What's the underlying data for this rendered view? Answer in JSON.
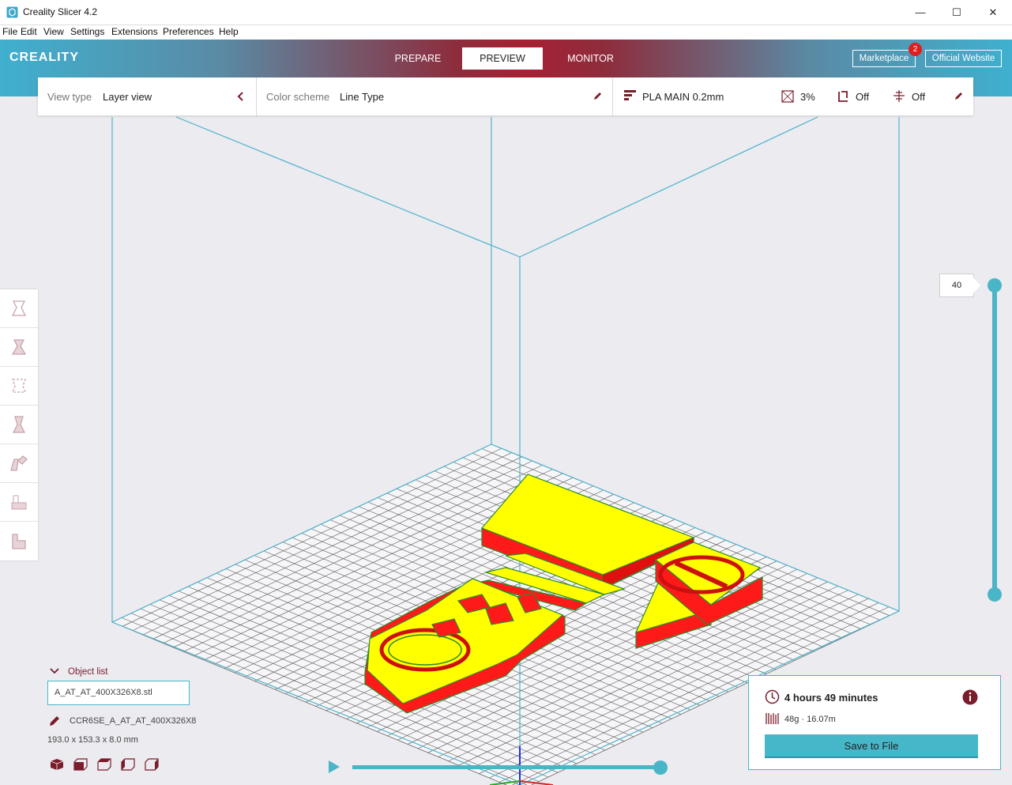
{
  "window": {
    "title": "Creality Slicer 4.2",
    "controls": {
      "minimize": "—",
      "maximize": "☐",
      "close": "✕"
    }
  },
  "menu": [
    "File",
    "Edit",
    "View",
    "Settings",
    "Extensions",
    "Preferences",
    "Help"
  ],
  "header": {
    "logo": "CREALITY",
    "tabs": [
      {
        "label": "PREPARE",
        "active": false
      },
      {
        "label": "PREVIEW",
        "active": true
      },
      {
        "label": "MONITOR",
        "active": false
      }
    ],
    "marketplace": {
      "label": "Marketplace",
      "badge": "2"
    },
    "official_website": "Official Website"
  },
  "toolbar": {
    "view_type_label": "View type",
    "view_type_value": "Layer view",
    "color_scheme_label": "Color scheme",
    "color_scheme_value": "Line Type",
    "profile": "PLA MAIN 0.2mm",
    "infill": "3%",
    "support": "Off",
    "adhesion": "Off"
  },
  "left_tools": [
    "front-view-icon",
    "top-view-icon",
    "left-view-icon",
    "right-view-icon",
    "per-model-settings-icon",
    "support-blocker-icon",
    "layer-stack-icon"
  ],
  "layer_slider": {
    "current_layer": "40"
  },
  "object_list": {
    "header": "Object list",
    "file": "A_AT_AT_400X326X8.stl",
    "job_name": "CCR6SE_A_AT_AT_400X326X8",
    "dimensions": "193.0 x 153.3 x 8.0 mm"
  },
  "print_summary": {
    "time": "4 hours 49 minutes",
    "material": "48g · 16.07m",
    "save_label": "Save to File"
  },
  "colors": {
    "accent": "#46b7c9",
    "brand_red": "#a62133",
    "model_fill": "#ffff00",
    "model_wall": "#ff1a1a",
    "model_outline": "#2c8a2c"
  }
}
